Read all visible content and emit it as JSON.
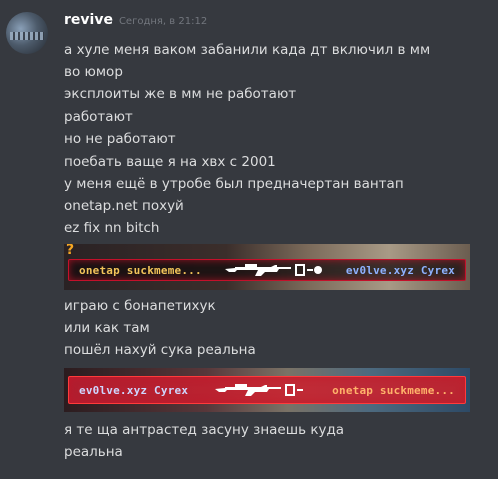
{
  "message": {
    "username": "revive",
    "timestamp": "Сегодня, в 21:12",
    "lines_a": [
      "а хуле меня ваком забанили када дт включил в мм",
      "во юмор",
      "эксплоиты же в мм не работают",
      "работают",
      "но не работают",
      "поебать ваще я на хвх с 2001",
      "у меня ещё в утробе был предначертан вантап",
      "onetap.net похуй",
      "ez fix nn bitch"
    ],
    "lines_b": [
      "играю с бонапетихук",
      "или как там",
      "пошёл нахуй сука реальна"
    ],
    "lines_c": [
      "я те ща антрастед засуну знаешь куда",
      "реальна"
    ]
  },
  "sticker1": {
    "left_text": "onetap suckmeme...",
    "right_text": "ev0lve.xyz Cyrex",
    "mark": "?"
  },
  "sticker2": {
    "left_text": "ev0lve.xyz Cyrex",
    "right_text": "onetap suckmeme..."
  }
}
